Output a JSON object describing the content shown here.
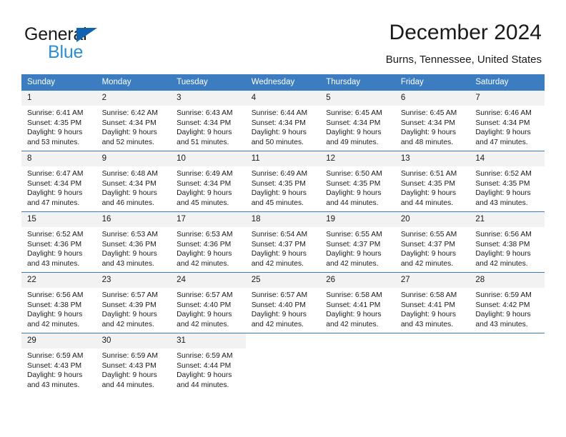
{
  "brand": {
    "name_dark": "General",
    "name_light": "Blue",
    "triangle_color": "#1263af",
    "light_color": "#2a8fd4"
  },
  "header": {
    "title": "December 2024",
    "subtitle": "Burns, Tennessee, United States"
  },
  "calendar": {
    "header_bg": "#3b7dc0",
    "daynum_bg": "#f2f2f2",
    "weekdays": [
      "Sunday",
      "Monday",
      "Tuesday",
      "Wednesday",
      "Thursday",
      "Friday",
      "Saturday"
    ],
    "weeks": [
      [
        {
          "day": "1",
          "sunrise": "Sunrise: 6:41 AM",
          "sunset": "Sunset: 4:35 PM",
          "daylight1": "Daylight: 9 hours",
          "daylight2": "and 53 minutes."
        },
        {
          "day": "2",
          "sunrise": "Sunrise: 6:42 AM",
          "sunset": "Sunset: 4:34 PM",
          "daylight1": "Daylight: 9 hours",
          "daylight2": "and 52 minutes."
        },
        {
          "day": "3",
          "sunrise": "Sunrise: 6:43 AM",
          "sunset": "Sunset: 4:34 PM",
          "daylight1": "Daylight: 9 hours",
          "daylight2": "and 51 minutes."
        },
        {
          "day": "4",
          "sunrise": "Sunrise: 6:44 AM",
          "sunset": "Sunset: 4:34 PM",
          "daylight1": "Daylight: 9 hours",
          "daylight2": "and 50 minutes."
        },
        {
          "day": "5",
          "sunrise": "Sunrise: 6:45 AM",
          "sunset": "Sunset: 4:34 PM",
          "daylight1": "Daylight: 9 hours",
          "daylight2": "and 49 minutes."
        },
        {
          "day": "6",
          "sunrise": "Sunrise: 6:45 AM",
          "sunset": "Sunset: 4:34 PM",
          "daylight1": "Daylight: 9 hours",
          "daylight2": "and 48 minutes."
        },
        {
          "day": "7",
          "sunrise": "Sunrise: 6:46 AM",
          "sunset": "Sunset: 4:34 PM",
          "daylight1": "Daylight: 9 hours",
          "daylight2": "and 47 minutes."
        }
      ],
      [
        {
          "day": "8",
          "sunrise": "Sunrise: 6:47 AM",
          "sunset": "Sunset: 4:34 PM",
          "daylight1": "Daylight: 9 hours",
          "daylight2": "and 47 minutes."
        },
        {
          "day": "9",
          "sunrise": "Sunrise: 6:48 AM",
          "sunset": "Sunset: 4:34 PM",
          "daylight1": "Daylight: 9 hours",
          "daylight2": "and 46 minutes."
        },
        {
          "day": "10",
          "sunrise": "Sunrise: 6:49 AM",
          "sunset": "Sunset: 4:34 PM",
          "daylight1": "Daylight: 9 hours",
          "daylight2": "and 45 minutes."
        },
        {
          "day": "11",
          "sunrise": "Sunrise: 6:49 AM",
          "sunset": "Sunset: 4:35 PM",
          "daylight1": "Daylight: 9 hours",
          "daylight2": "and 45 minutes."
        },
        {
          "day": "12",
          "sunrise": "Sunrise: 6:50 AM",
          "sunset": "Sunset: 4:35 PM",
          "daylight1": "Daylight: 9 hours",
          "daylight2": "and 44 minutes."
        },
        {
          "day": "13",
          "sunrise": "Sunrise: 6:51 AM",
          "sunset": "Sunset: 4:35 PM",
          "daylight1": "Daylight: 9 hours",
          "daylight2": "and 44 minutes."
        },
        {
          "day": "14",
          "sunrise": "Sunrise: 6:52 AM",
          "sunset": "Sunset: 4:35 PM",
          "daylight1": "Daylight: 9 hours",
          "daylight2": "and 43 minutes."
        }
      ],
      [
        {
          "day": "15",
          "sunrise": "Sunrise: 6:52 AM",
          "sunset": "Sunset: 4:36 PM",
          "daylight1": "Daylight: 9 hours",
          "daylight2": "and 43 minutes."
        },
        {
          "day": "16",
          "sunrise": "Sunrise: 6:53 AM",
          "sunset": "Sunset: 4:36 PM",
          "daylight1": "Daylight: 9 hours",
          "daylight2": "and 43 minutes."
        },
        {
          "day": "17",
          "sunrise": "Sunrise: 6:53 AM",
          "sunset": "Sunset: 4:36 PM",
          "daylight1": "Daylight: 9 hours",
          "daylight2": "and 42 minutes."
        },
        {
          "day": "18",
          "sunrise": "Sunrise: 6:54 AM",
          "sunset": "Sunset: 4:37 PM",
          "daylight1": "Daylight: 9 hours",
          "daylight2": "and 42 minutes."
        },
        {
          "day": "19",
          "sunrise": "Sunrise: 6:55 AM",
          "sunset": "Sunset: 4:37 PM",
          "daylight1": "Daylight: 9 hours",
          "daylight2": "and 42 minutes."
        },
        {
          "day": "20",
          "sunrise": "Sunrise: 6:55 AM",
          "sunset": "Sunset: 4:37 PM",
          "daylight1": "Daylight: 9 hours",
          "daylight2": "and 42 minutes."
        },
        {
          "day": "21",
          "sunrise": "Sunrise: 6:56 AM",
          "sunset": "Sunset: 4:38 PM",
          "daylight1": "Daylight: 9 hours",
          "daylight2": "and 42 minutes."
        }
      ],
      [
        {
          "day": "22",
          "sunrise": "Sunrise: 6:56 AM",
          "sunset": "Sunset: 4:38 PM",
          "daylight1": "Daylight: 9 hours",
          "daylight2": "and 42 minutes."
        },
        {
          "day": "23",
          "sunrise": "Sunrise: 6:57 AM",
          "sunset": "Sunset: 4:39 PM",
          "daylight1": "Daylight: 9 hours",
          "daylight2": "and 42 minutes."
        },
        {
          "day": "24",
          "sunrise": "Sunrise: 6:57 AM",
          "sunset": "Sunset: 4:40 PM",
          "daylight1": "Daylight: 9 hours",
          "daylight2": "and 42 minutes."
        },
        {
          "day": "25",
          "sunrise": "Sunrise: 6:57 AM",
          "sunset": "Sunset: 4:40 PM",
          "daylight1": "Daylight: 9 hours",
          "daylight2": "and 42 minutes."
        },
        {
          "day": "26",
          "sunrise": "Sunrise: 6:58 AM",
          "sunset": "Sunset: 4:41 PM",
          "daylight1": "Daylight: 9 hours",
          "daylight2": "and 42 minutes."
        },
        {
          "day": "27",
          "sunrise": "Sunrise: 6:58 AM",
          "sunset": "Sunset: 4:41 PM",
          "daylight1": "Daylight: 9 hours",
          "daylight2": "and 43 minutes."
        },
        {
          "day": "28",
          "sunrise": "Sunrise: 6:59 AM",
          "sunset": "Sunset: 4:42 PM",
          "daylight1": "Daylight: 9 hours",
          "daylight2": "and 43 minutes."
        }
      ],
      [
        {
          "day": "29",
          "sunrise": "Sunrise: 6:59 AM",
          "sunset": "Sunset: 4:43 PM",
          "daylight1": "Daylight: 9 hours",
          "daylight2": "and 43 minutes."
        },
        {
          "day": "30",
          "sunrise": "Sunrise: 6:59 AM",
          "sunset": "Sunset: 4:43 PM",
          "daylight1": "Daylight: 9 hours",
          "daylight2": "and 44 minutes."
        },
        {
          "day": "31",
          "sunrise": "Sunrise: 6:59 AM",
          "sunset": "Sunset: 4:44 PM",
          "daylight1": "Daylight: 9 hours",
          "daylight2": "and 44 minutes."
        },
        {
          "day": "",
          "sunrise": "",
          "sunset": "",
          "daylight1": "",
          "daylight2": ""
        },
        {
          "day": "",
          "sunrise": "",
          "sunset": "",
          "daylight1": "",
          "daylight2": ""
        },
        {
          "day": "",
          "sunrise": "",
          "sunset": "",
          "daylight1": "",
          "daylight2": ""
        },
        {
          "day": "",
          "sunrise": "",
          "sunset": "",
          "daylight1": "",
          "daylight2": ""
        }
      ]
    ]
  }
}
